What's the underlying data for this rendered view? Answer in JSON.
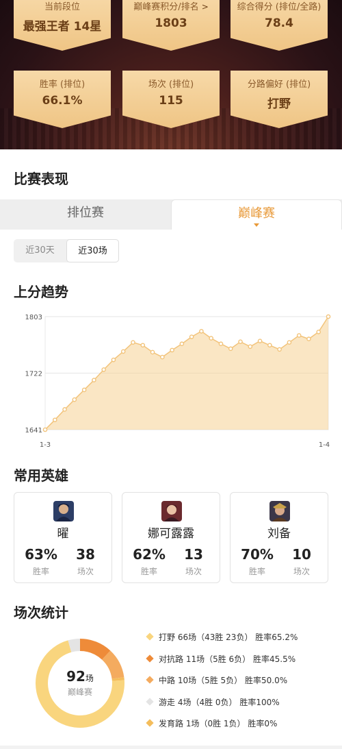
{
  "header": {
    "stats": [
      {
        "label": "当前段位",
        "value": "最强王者 14星"
      },
      {
        "label": "巅峰赛积分/排名",
        "value": "1803",
        "chevron": ">"
      },
      {
        "label": "综合得分 (排位/全路)",
        "value": "78.4"
      },
      {
        "label": "胜率 (排位)",
        "value": "66.1%"
      },
      {
        "label": "场次 (排位)",
        "value": "115"
      },
      {
        "label": "分路偏好 (排位)",
        "value": "打野"
      }
    ]
  },
  "section_performance": "比赛表现",
  "tabs": [
    {
      "label": "排位赛",
      "active": false
    },
    {
      "label": "巅峰赛",
      "active": true
    }
  ],
  "range_toggle": [
    {
      "label": "近30天",
      "active": false
    },
    {
      "label": "近30场",
      "active": true
    }
  ],
  "section_trend": "上分趋势",
  "chart_data": {
    "type": "area",
    "title": "上分趋势",
    "x_start_label": "1-3",
    "x_end_label": "1-4",
    "y_ticks": [
      1641,
      1722,
      1803
    ],
    "ylim": [
      1641,
      1803
    ],
    "grid": true,
    "color": "#f5d193",
    "line_color": "#f2c37a",
    "values": [
      1641,
      1655,
      1670,
      1684,
      1698,
      1712,
      1727,
      1741,
      1753,
      1766,
      1762,
      1752,
      1745,
      1755,
      1764,
      1774,
      1782,
      1772,
      1764,
      1757,
      1767,
      1760,
      1768,
      1762,
      1756,
      1766,
      1776,
      1771,
      1781,
      1803
    ]
  },
  "section_heroes": "常用英雄",
  "heroes": [
    {
      "name": "曜",
      "win_rate": "63%",
      "win_rate_label": "胜率",
      "games": "38",
      "games_label": "场次",
      "avatar_color": "#2d3e66"
    },
    {
      "name": "娜可露露",
      "win_rate": "62%",
      "win_rate_label": "胜率",
      "games": "13",
      "games_label": "场次",
      "avatar_color": "#6b2a2e"
    },
    {
      "name": "刘备",
      "win_rate": "70%",
      "win_rate_label": "胜率",
      "games": "10",
      "games_label": "场次",
      "avatar_color": "#3b3648"
    }
  ],
  "section_stats": "场次统计",
  "donut": {
    "total": "92",
    "unit": "场",
    "subtitle": "巅峰赛",
    "segments": [
      {
        "name": "打野",
        "count": 66,
        "color": "#f9d57e",
        "text": "打野 66场（43胜 23负） 胜率65.2%"
      },
      {
        "name": "对抗路",
        "count": 11,
        "color": "#ee8b39",
        "text": "对抗路 11场（5胜 6负） 胜率45.5%"
      },
      {
        "name": "中路",
        "count": 10,
        "color": "#f4ab5f",
        "text": "中路 10场（5胜 5负） 胜率50.0%"
      },
      {
        "name": "游走",
        "count": 4,
        "color": "#e4e4e4",
        "text": "游走 4场（4胜 0负） 胜率100%"
      },
      {
        "name": "发育路",
        "count": 1,
        "color": "#f4bd5c",
        "text": "发育路 1场（0胜 1负） 胜率0%"
      }
    ]
  }
}
